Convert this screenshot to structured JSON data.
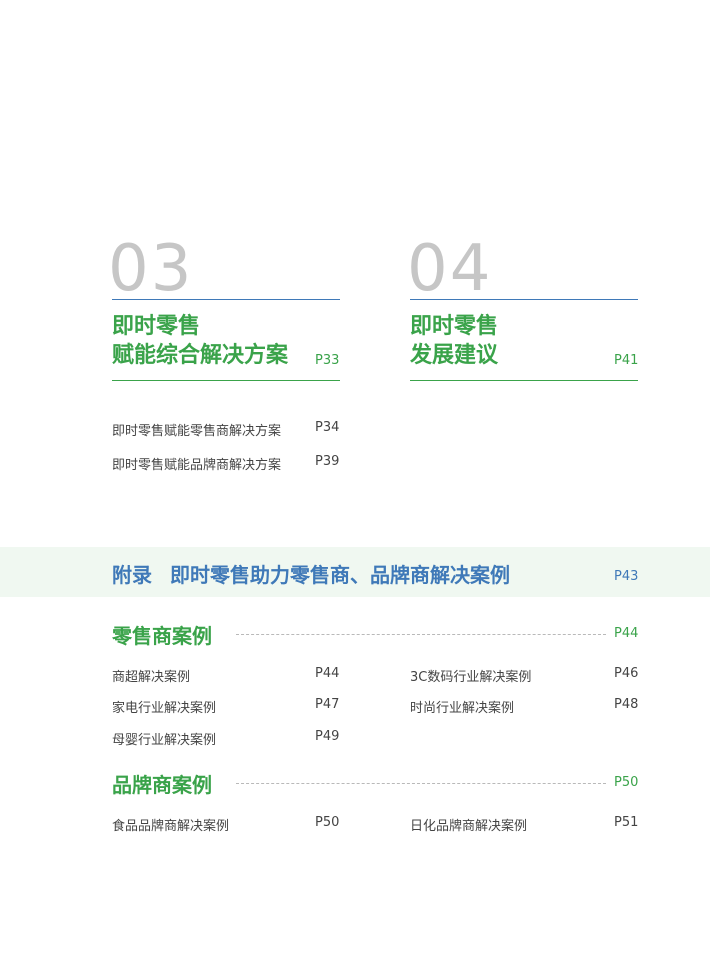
{
  "sections": [
    {
      "number": "03",
      "title_line1": "即时零售",
      "title_line2": "赋能综合解决方案",
      "page": "P33",
      "items": [
        {
          "label": "即时零售赋能零售商解决方案",
          "page": "P34"
        },
        {
          "label": "即时零售赋能品牌商解决方案",
          "page": "P39"
        }
      ]
    },
    {
      "number": "04",
      "title_line1": "即时零售",
      "title_line2": "发展建议",
      "page": "P41"
    }
  ],
  "appendix": {
    "prefix": "附录",
    "title": "即时零售助力零售商、品牌商解决案例",
    "page": "P43"
  },
  "retailer_cases": {
    "title": "零售商案例",
    "page": "P44",
    "items": [
      {
        "label": "商超解决案例",
        "page": "P44"
      },
      {
        "label": "3C数码行业解决案例",
        "page": "P46"
      },
      {
        "label": "家电行业解决案例",
        "page": "P47"
      },
      {
        "label": "时尚行业解决案例",
        "page": "P48"
      },
      {
        "label": "母婴行业解决案例",
        "page": "P49"
      }
    ]
  },
  "brand_cases": {
    "title": "品牌商案例",
    "page": "P50",
    "items": [
      {
        "label": "食品品牌商解决案例",
        "page": "P50"
      },
      {
        "label": "日化品牌商解决案例",
        "page": "P51"
      }
    ]
  },
  "colors": {
    "green": "#3aa34a",
    "blue": "#3f79b8",
    "number_gray": "#c6c6c6",
    "band": "#f0f8f1"
  }
}
